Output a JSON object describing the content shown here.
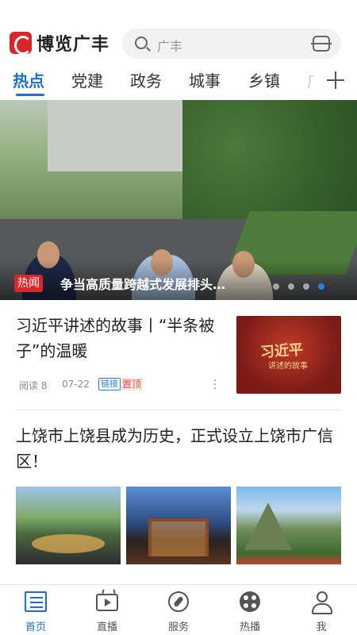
{
  "header": {
    "app_name": "博览广丰",
    "search_placeholder": "广丰"
  },
  "tabs": [
    {
      "label": "热点",
      "active": true
    },
    {
      "label": "党建"
    },
    {
      "label": "政务"
    },
    {
      "label": "城事"
    },
    {
      "label": "乡镇"
    },
    {
      "label": "广"
    }
  ],
  "banner": {
    "tag": "热闻",
    "title": "争当高质量跨越式发展排头…",
    "page_count": 4,
    "active_index": 4
  },
  "articles": [
    {
      "title": "习近平讲述的故事丨“半条被子”的温暖",
      "thumb_text": "习近平",
      "thumb_subtext": "讲述的故事",
      "reads_label": "阅读 8",
      "date": "07-22",
      "badge_link": "链接",
      "badge_top": "置顶"
    },
    {
      "title": "上饶市上饶县成为历史，正式设立上饶市广信区！"
    }
  ],
  "bottom_nav": [
    {
      "label": "首页",
      "icon": "news-icon",
      "active": true
    },
    {
      "label": "直播",
      "icon": "tv-icon"
    },
    {
      "label": "服务",
      "icon": "compass-icon"
    },
    {
      "label": "热播",
      "icon": "film-reel-icon"
    },
    {
      "label": "我",
      "icon": "user-icon"
    }
  ],
  "colors": {
    "accent": "#1f6fd0",
    "brand_red": "#d8262b"
  }
}
